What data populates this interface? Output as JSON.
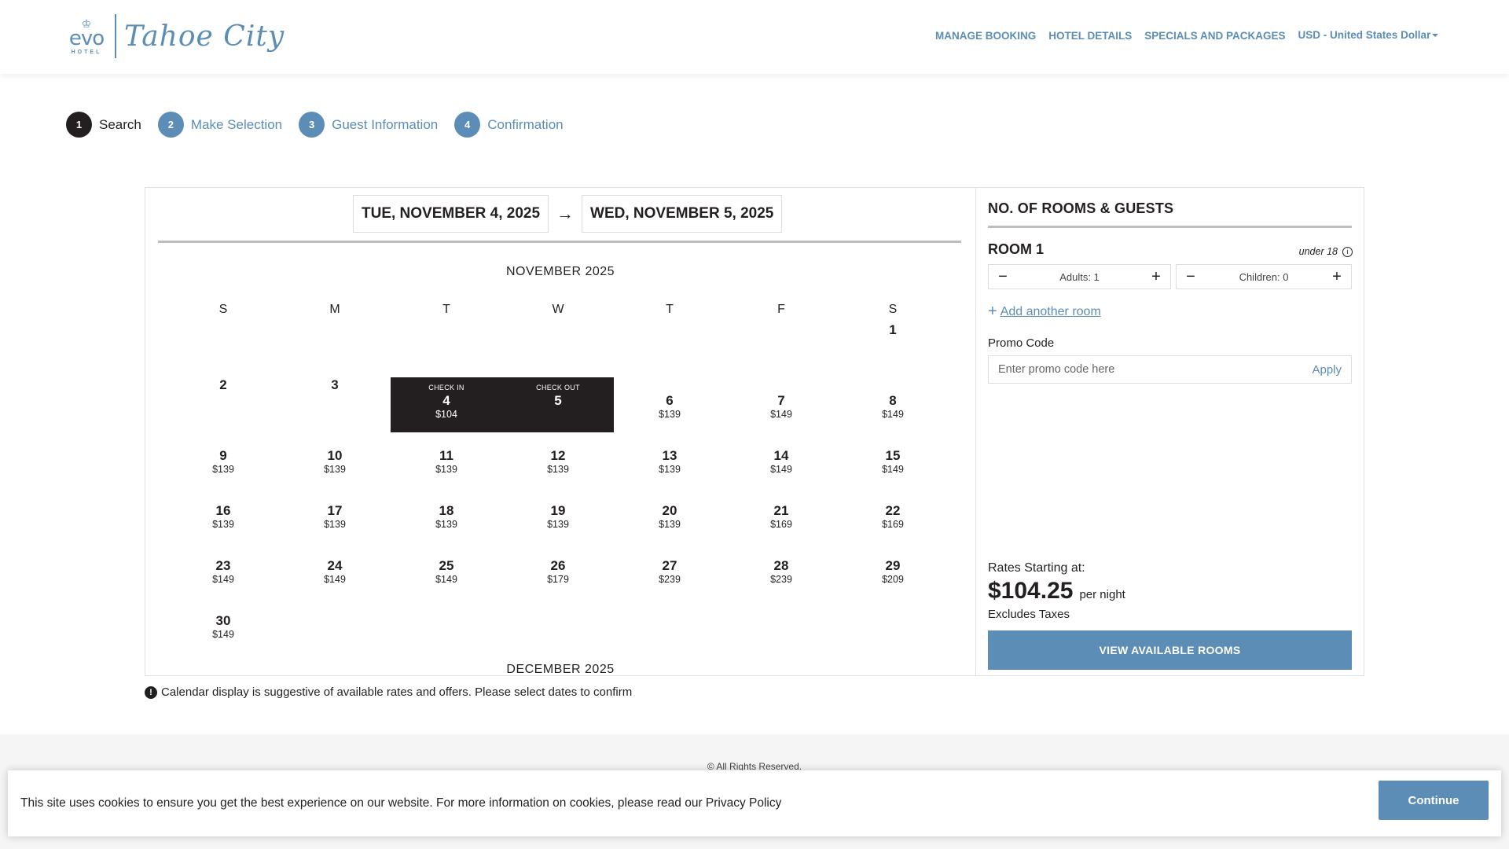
{
  "brand": {
    "logo_mark": "evo",
    "logo_hotel": "HOTEL",
    "logo_script": "Tahoe City"
  },
  "nav": {
    "items": [
      "MANAGE BOOKING",
      "HOTEL DETAILS",
      "SPECIALS AND PACKAGES"
    ],
    "currency": "USD - United States Dollar"
  },
  "steps": [
    {
      "num": "1",
      "label": "Search",
      "active": true
    },
    {
      "num": "2",
      "label": "Make Selection",
      "active": false
    },
    {
      "num": "3",
      "label": "Guest Information",
      "active": false
    },
    {
      "num": "4",
      "label": "Confirmation",
      "active": false
    }
  ],
  "dates": {
    "check_in": "TUE, NOVEMBER 4, 2025",
    "arrow": "→",
    "check_out": "WED, NOVEMBER 5, 2025"
  },
  "calendar": {
    "month": "NOVEMBER 2025",
    "next_month": "DECEMBER 2025",
    "weekdays": [
      "S",
      "M",
      "T",
      "W",
      "T",
      "F",
      "S"
    ],
    "first_weekday": 6,
    "days": [
      {
        "d": "1",
        "price": "",
        "state": "unavailable",
        "label": ""
      },
      {
        "d": "2",
        "price": "",
        "state": "unavailable",
        "label": ""
      },
      {
        "d": "3",
        "price": "",
        "state": "unavailable",
        "label": ""
      },
      {
        "d": "4",
        "price": "$104",
        "state": "selected",
        "label": "CHECK IN"
      },
      {
        "d": "5",
        "price": "",
        "state": "selected",
        "label": "CHECK OUT"
      },
      {
        "d": "6",
        "price": "$139",
        "state": "available",
        "label": ""
      },
      {
        "d": "7",
        "price": "$149",
        "state": "available",
        "label": ""
      },
      {
        "d": "8",
        "price": "$149",
        "state": "available",
        "label": ""
      },
      {
        "d": "9",
        "price": "$139",
        "state": "available",
        "label": ""
      },
      {
        "d": "10",
        "price": "$139",
        "state": "available",
        "label": ""
      },
      {
        "d": "11",
        "price": "$139",
        "state": "available",
        "label": ""
      },
      {
        "d": "12",
        "price": "$139",
        "state": "available",
        "label": ""
      },
      {
        "d": "13",
        "price": "$139",
        "state": "available",
        "label": ""
      },
      {
        "d": "14",
        "price": "$149",
        "state": "available",
        "label": ""
      },
      {
        "d": "15",
        "price": "$149",
        "state": "available",
        "label": ""
      },
      {
        "d": "16",
        "price": "$139",
        "state": "available",
        "label": ""
      },
      {
        "d": "17",
        "price": "$139",
        "state": "available",
        "label": ""
      },
      {
        "d": "18",
        "price": "$139",
        "state": "available",
        "label": ""
      },
      {
        "d": "19",
        "price": "$139",
        "state": "available",
        "label": ""
      },
      {
        "d": "20",
        "price": "$139",
        "state": "available",
        "label": ""
      },
      {
        "d": "21",
        "price": "$169",
        "state": "available",
        "label": ""
      },
      {
        "d": "22",
        "price": "$169",
        "state": "available",
        "label": ""
      },
      {
        "d": "23",
        "price": "$149",
        "state": "available",
        "label": ""
      },
      {
        "d": "24",
        "price": "$149",
        "state": "available",
        "label": ""
      },
      {
        "d": "25",
        "price": "$149",
        "state": "available",
        "label": ""
      },
      {
        "d": "26",
        "price": "$179",
        "state": "available",
        "label": ""
      },
      {
        "d": "27",
        "price": "$239",
        "state": "available",
        "label": ""
      },
      {
        "d": "28",
        "price": "$239",
        "state": "available",
        "label": ""
      },
      {
        "d": "29",
        "price": "$209",
        "state": "available",
        "label": ""
      },
      {
        "d": "30",
        "price": "$149",
        "state": "available",
        "label": ""
      }
    ]
  },
  "rooms": {
    "title": "NO. OF ROOMS & GUESTS",
    "room_label": "ROOM 1",
    "children_note": "under 18",
    "adults": "Adults: 1",
    "children": "Children: 0",
    "minus": "−",
    "plus": "+",
    "add_room": "Add another room"
  },
  "promo": {
    "label": "Promo Code",
    "placeholder": "Enter promo code here",
    "apply": "Apply"
  },
  "rates": {
    "label": "Rates Starting at:",
    "price": "$104.25",
    "per": "per night",
    "excludes": "Excludes Taxes",
    "button": "VIEW AVAILABLE ROOMS"
  },
  "disclaimer": "Calendar display is suggestive of available rates and offers. Please select dates to confirm",
  "footer": "© All Rights Reserved.",
  "cookie": {
    "text": "This site uses cookies to ensure you get the best experience on our website. For more information on cookies, please read our Privacy Policy",
    "button": "Continue"
  },
  "colors": {
    "accent": "#5b8db6",
    "dark": "#231f20"
  }
}
